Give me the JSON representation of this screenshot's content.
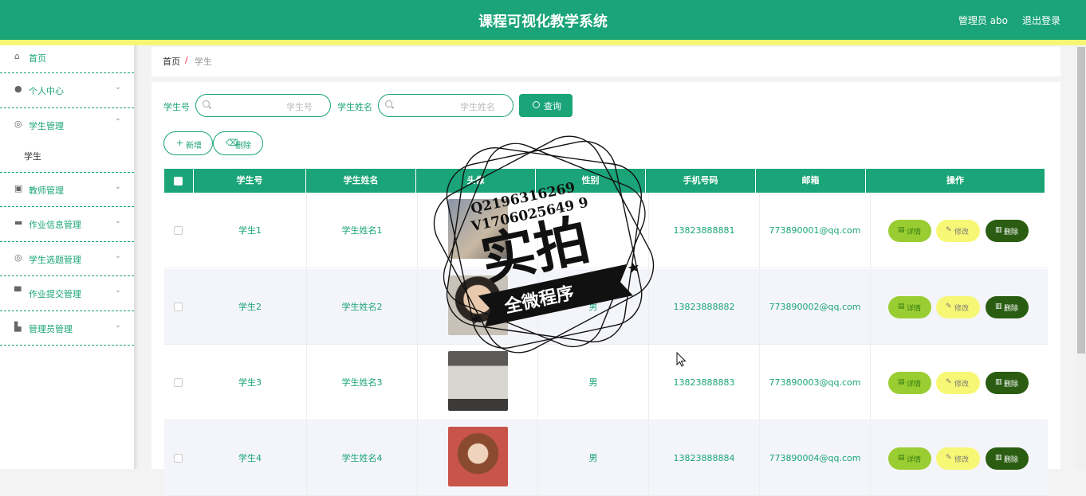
{
  "header": {
    "title": "课程可视化教学系统",
    "admin": "管理员 abo",
    "logout": "退出登录"
  },
  "sidebar": {
    "items": [
      {
        "label": "首页",
        "icon": "home-icon"
      },
      {
        "label": "个人中心",
        "icon": "user-icon"
      },
      {
        "label": "学生管理",
        "icon": "compass-icon",
        "sub": "学生"
      },
      {
        "label": "教师管理",
        "icon": "clipboard-icon"
      },
      {
        "label": "作业信息管理",
        "icon": "briefcase-icon"
      },
      {
        "label": "学生选题管理",
        "icon": "compass-icon"
      },
      {
        "label": "作业提交管理",
        "icon": "monitor-icon"
      },
      {
        "label": "管理员管理",
        "icon": "folder-icon"
      }
    ]
  },
  "breadcrumb": {
    "home": "首页",
    "sep": "/",
    "current": "学生"
  },
  "search": {
    "no_label": "学生号",
    "no_placeholder": "学生号",
    "name_label": "学生姓名",
    "name_placeholder": "学生姓名",
    "query": "查询"
  },
  "actions": {
    "add": "新增",
    "delete": "删除"
  },
  "table": {
    "headers": [
      "学生号",
      "学生姓名",
      "头像",
      "性别",
      "手机号码",
      "邮箱",
      "操作"
    ],
    "rows": [
      {
        "no": "学生1",
        "name": "学生姓名1",
        "gender": "",
        "phone": "13823888881",
        "email": "773890001@qq.com"
      },
      {
        "no": "学生2",
        "name": "学生姓名2",
        "gender": "男",
        "phone": "13823888882",
        "email": "773890002@qq.com"
      },
      {
        "no": "学生3",
        "name": "学生姓名3",
        "gender": "男",
        "phone": "13823888883",
        "email": "773890003@qq.com"
      },
      {
        "no": "学生4",
        "name": "学生姓名4",
        "gender": "男",
        "phone": "13823888884",
        "email": "773890004@qq.com"
      }
    ],
    "btn_detail": "详情",
    "btn_edit": "修改",
    "btn_delete": "删除"
  },
  "watermark": {
    "line1": "Q2196316269",
    "line2": "V1706025649 9",
    "main": "实拍",
    "banner": "全微程序"
  }
}
